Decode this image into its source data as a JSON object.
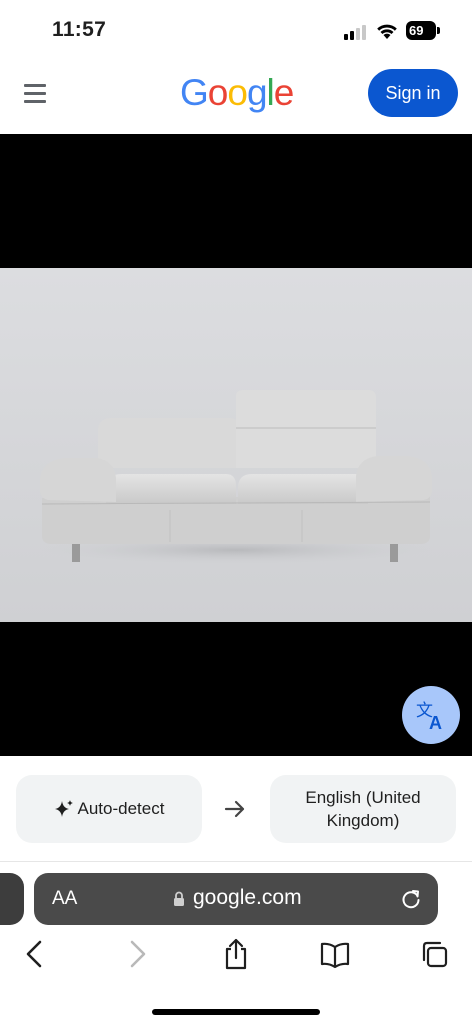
{
  "status_bar": {
    "time": "11:57",
    "battery": "69",
    "icons": [
      "signal-icon",
      "wifi-icon",
      "battery-icon"
    ]
  },
  "header": {
    "logo_letters": [
      {
        "char": "G",
        "color": "#4285F4"
      },
      {
        "char": "o",
        "color": "#EA4335"
      },
      {
        "char": "o",
        "color": "#FBBC05"
      },
      {
        "char": "g",
        "color": "#4285F4"
      },
      {
        "char": "l",
        "color": "#34A853"
      },
      {
        "char": "e",
        "color": "#EA4335"
      }
    ],
    "signin_label": "Sign in",
    "accent": "#0b57d0"
  },
  "viewer": {
    "image_subject_icon": "sofa-image",
    "translate_fab_icon": "translate-icon"
  },
  "translate_bar": {
    "source_language": "Auto-detect",
    "target_language": "English (United Kingdom)"
  },
  "browser": {
    "aa_label": "AA",
    "url": "google.com",
    "toolbar_icons": [
      "back-icon",
      "forward-icon",
      "share-icon",
      "bookmarks-icon",
      "tabs-icon"
    ]
  }
}
